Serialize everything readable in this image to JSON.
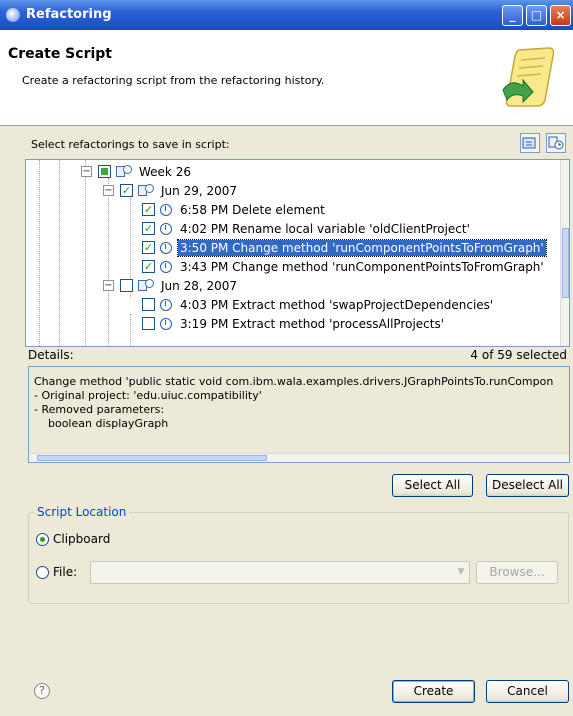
{
  "window": {
    "title": "Refactoring"
  },
  "header": {
    "title": "Create Script",
    "description": "Create a refactoring script from the refactoring history."
  },
  "tree_section": {
    "label": "Select refactorings to save in script:"
  },
  "tree": {
    "rows": [
      {
        "label": "Week 26"
      },
      {
        "label": "Jun 29, 2007"
      },
      {
        "label": "6:58 PM Delete element"
      },
      {
        "label": "4:02 PM Rename local variable 'oldClientProject'"
      },
      {
        "label": "3:50 PM Change method 'runComponentPointsToFromGraph'"
      },
      {
        "label": "3:43 PM Change method 'runComponentPointsToFromGraph'"
      },
      {
        "label": "Jun 28, 2007"
      },
      {
        "label": "4:03 PM Extract method 'swapProjectDependencies'"
      },
      {
        "label": "3:19 PM Extract method 'processAllProjects'"
      }
    ]
  },
  "details": {
    "label": "Details:",
    "selected_count": "4 of 59 selected",
    "lines": [
      "Change method 'public static void com.ibm.wala.examples.drivers.JGraphPointsTo.runCompon",
      "- Original project: 'edu.uiuc.compatibility'",
      "- Removed parameters:",
      "    boolean displayGraph"
    ]
  },
  "buttons": {
    "select_all": "Select All",
    "deselect_all": "Deselect All",
    "browse": "Browse...",
    "create": "Create",
    "cancel": "Cancel"
  },
  "script_location": {
    "title": "Script Location",
    "clipboard_label": "Clipboard",
    "file_label": "File:",
    "file_value": "",
    "selected": "clipboard"
  },
  "icons": [
    "refactoring-app-icon",
    "minimize-icon",
    "maximize-icon",
    "close-icon",
    "script-banner-icon",
    "import-icon",
    "sort-icon",
    "folder-icon",
    "clock-icon",
    "help-icon"
  ],
  "colors": {
    "selection": "#316ac5",
    "titlebar": "#2a62d8",
    "group_title": "#0046d5"
  }
}
